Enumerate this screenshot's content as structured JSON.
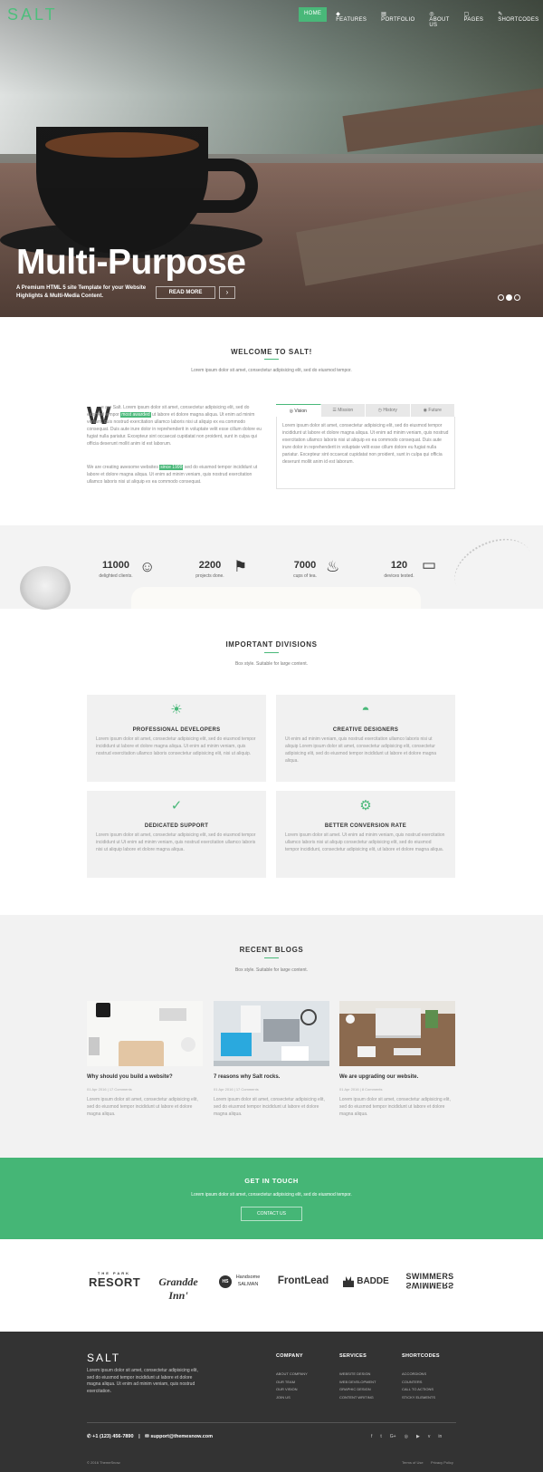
{
  "brand": {
    "logo": "SALT",
    "accent": "#49b879"
  },
  "nav": [
    {
      "label": "Home",
      "icon": "home-icon"
    },
    {
      "label": "◆ Features",
      "icon": "drop-icon"
    },
    {
      "label": "▤ Portfolio",
      "icon": "grid-icon"
    },
    {
      "label": "◎ About us",
      "icon": "user-icon"
    },
    {
      "label": "▢ Pages",
      "icon": "pages-icon"
    },
    {
      "label": "✎ Shortcodes",
      "icon": "pen-icon"
    }
  ],
  "hero": {
    "title": "Multi-Purpose",
    "subtitle": "A Premium HTML 5 site Template for your Website Highlights & Multi-Media Content.",
    "read_more": "READ MORE",
    "arrow": "›"
  },
  "welcome": {
    "title": "WELCOME TO SALT!",
    "subtitle": "Lorem ipsum dolor sit amet, consectetur adipisicing elit, sed do eiusmod tempor.",
    "dropcap": "W",
    "p1a": "e are Salt. Lorem ipsum dolor sit amet, consectetur adipisicing elit, sed do eiusmod tempor",
    "p1hl": "most awarded",
    "p1b": "ut labore et dolore magna aliqua. Ut enim ad minim veniam, quis nostrud exercitation ullamco laboris nisi ut aliquip ex ea commodo consequat. Duis aute irure dolor in reprehenderit in voluptate velit esse cillum dolore eu fugiat nulla pariatur. Excepteur sint occaecat cupidatat non proident, sunt in culpa qui officia deserunt mollit anim id est laborum.",
    "p2a": "We are creating awesome websites",
    "p2hl": "since 1999",
    "p2b": "sed do eiusmod tempor incididunt ut labore et dolore magna aliqua. Ut enim ad minim veniam, quis nostrud exercitation ullamco laboris nisi ut aliquip ex ea commodo consequat.",
    "tabs": [
      "◎ Vision",
      "☰ Mission",
      "◷ History",
      "◉ Future"
    ],
    "tab_text": "Lorem ipsum dolor sit amet, consectetur adipisicing elit, sed do eiusmod tempor incididunt ut labore et dolore magna aliqua. Ut enim ad minim veniam, quis nostrud exercitation ullamco laboris nisi ut aliquip ex ea commodo consequat. Duis aute irure dolor in reprehenderit in voluptate velit esse cillum dolore eu fugiat nulla pariatur. Excepteur sint occaecat cupidatat non proident, sunt in culpa qui officia deserunt mollit anim id est laborum."
  },
  "stats": [
    {
      "num": "11000",
      "label": "delighted clients.",
      "icon": "☺"
    },
    {
      "num": "2200",
      "label": "projects done.",
      "icon": "⚑"
    },
    {
      "num": "7000",
      "label": "cups of tea.",
      "icon": "♨"
    },
    {
      "num": "120",
      "label": "devices tested.",
      "icon": "▭"
    }
  ],
  "divisions": {
    "title": "IMPORTANT DIVISIONS",
    "subtitle": "Box style. Suitable for large content.",
    "cards": [
      {
        "title": "PROFESSIONAL DEVELOPERS",
        "icon": "☀",
        "text": "Lorem ipsum dolor sit amet, consectetur adipisicing elit, sed do eiusmod tempor incididunt ut labore et dolore magna aliqua. Ut enim ad minim veniam, quis nostrud exercitation ullamco laboris consectetur adipisicing elit, nisi ut aliquip."
      },
      {
        "title": "CREATIVE DESIGNERS",
        "icon": "◓",
        "text": "Ut enim ad minim veniam, quis nostrud exercitation ullamco laboris nisi ut aliquip Lorem ipsum dolor sit amet, consectetur adipisicing elit, consectetur adipisicing elit, sed do eiusmod tempor incididunt ut labore et dolore magna aliqua."
      },
      {
        "title": "DEDICATED SUPPORT",
        "icon": "✓",
        "text": "Lorem ipsum dolor sit amet, consectetur adipisicing elit, sed do eiusmod tempor incididunt ut Ut enim ad minim veniam, quis nostrud exercitation ullamco laboris nisi ut aliquip labore et dolore magna aliqua."
      },
      {
        "title": "BETTER CONVERSION RATE",
        "icon": "⚙",
        "text": "Lorem ipsum dolor sit amet. Ut enim ad minim veniam, quis nostrud exercitation ullamco laboris nisi ut aliquip consectetur adipisicing elit, sed do eiusmod tempor incididunt, consectetur adipisicing elit, ut labore et dolore magna aliqua."
      }
    ]
  },
  "blogs": {
    "title": "RECENT BLOGS",
    "subtitle": "Box style. Suitable for large content.",
    "posts": [
      {
        "title": "Why should you build a website?",
        "meta": "01 Apr 2016 | 17 Comments",
        "text": "Lorem ipsum dolor sit amet, consectetur adipisicing elit, sed do eiusmod tempor incididunt ut labore et dolore magna aliqua."
      },
      {
        "title": "7 reasons why Salt rocks.",
        "meta": "01 Apr 2016 | 17 Comments",
        "text": "Lorem ipsum dolor sit amet, consectetur adipisicing elit, sed do eiusmod tempor incididunt ut labore et dolore magna aliqua."
      },
      {
        "title": "We are upgrading our website.",
        "meta": "01 Apr 2016 | 8 Comments",
        "text": "Lorem ipsum dolor sit amet, consectetur adipisicing elit, sed do eiusmod tempor incididunt ut labore et dolore magna aliqua."
      }
    ]
  },
  "touch": {
    "title": "GET IN TOUCH",
    "subtitle": "Lorem ipsum dolor sit amet, consectetur adipisicing elit, sed do eiusmod tempor.",
    "button": "CONTACT US"
  },
  "clients": [
    {
      "top": "THE PARK",
      "name": "RESORT"
    },
    {
      "name": "Grandde Inn'"
    },
    {
      "badge": "HS",
      "name": "Handsome",
      "name2": "SALMAN"
    },
    {
      "name": "FrontLead"
    },
    {
      "name": "BADDE"
    },
    {
      "name": "SWIMMERS",
      "name2": "SWIMMERS"
    }
  ],
  "footer": {
    "logo": "SALT",
    "about": "Lorem ipsum dolor sit amet, consectetur adipisicing elit, sed do eiusmod tempor incididunt ut labore et dolore magna aliqua. Ut enim ad minim veniam, quis nostrud exercitation.",
    "cols": [
      {
        "title": "COMPANY",
        "links": [
          "ABOUT COMPANY",
          "OUR TEAM",
          "OUR VISION",
          "JOIN US"
        ]
      },
      {
        "title": "SERVICES",
        "links": [
          "WEBSITE DESIGN",
          "WEB DEVELOPMENT",
          "GRAPHIC DESIGN",
          "CONTENT WRITING"
        ]
      },
      {
        "title": "SHORTCODES",
        "links": [
          "ACCORDIONS",
          "COUNTERS",
          "CALL TO ACTIONS",
          "STICKY ELEMENTS"
        ]
      }
    ],
    "phone": "+1 (123) 456-7890",
    "email": "support@themesnow.com",
    "social": [
      "f",
      "t",
      "G+",
      "◎",
      "▶",
      "v",
      "in"
    ],
    "copyright": "© 2016 ThemeSnow.",
    "terms": "Terms of Use",
    "privacy": "Privacy Policy"
  }
}
